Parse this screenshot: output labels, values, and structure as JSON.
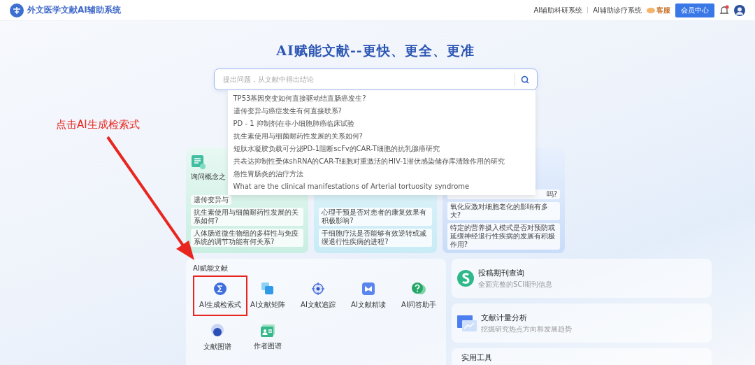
{
  "header": {
    "title": "外文医学文献AI辅助系统",
    "nav": [
      "AI辅助科研系统",
      "AI辅助诊疗系统"
    ],
    "service": "客服",
    "member_button": "会员中心",
    "notification": true
  },
  "hero": {
    "title": "AI赋能文献--更快、更全、更准"
  },
  "search": {
    "placeholder": "提出问题，从文献中得出结论",
    "suggestions": [
      "TP53基因突变如何直接驱动结直肠癌发生?",
      "遗传变异与癌症发生有何直接联系?",
      "PD - 1 抑制剂在非小细胞肺癌临床试验",
      "抗生素使用与细菌耐药性发展的关系如何?",
      "短肽水凝胶负载可分泌PD-1阻断scFv的CAR-T细胞的抗乳腺癌研究",
      "共表达抑制性受体shRNA的CAR-T细胞对重激活的HIV-1潜伏感染储存库清除作用的研究",
      "急性胃肠炎的治疗方法",
      "What are the clinical manifestations of Arterial tortuosity syndrome"
    ]
  },
  "annotation": {
    "text": "点击AI生成检索式"
  },
  "question_cards": [
    {
      "title": "询问概念之",
      "questions": [
        "遗传变异与",
        "抗生素使用与细菌耐药性发展的关系如何?",
        "人体肠道微生物组的多样性与免疫系统的调节功能有何关系?"
      ]
    },
    {
      "questions": [
        "心理干预是否对患者的康复效果有积极影响?",
        "干细胞疗法是否能够有效逆转或减缓退行性疾病的进程?"
      ]
    },
    {
      "questions": [
        "吗?",
        "氧化应激对细胞老化的影响有多大?",
        "特定的营养摄入模式是否对预防或延缓神经退行性疾病的发展有积极作用?"
      ]
    }
  ],
  "tools_section": {
    "title": "AI赋能文献",
    "tools": [
      {
        "label": "AI生成检索式",
        "kind": "sigma",
        "selected": true
      },
      {
        "label": "AI文献矩阵",
        "kind": "stack",
        "selected": false
      },
      {
        "label": "AI文献追踪",
        "kind": "target",
        "selected": false
      },
      {
        "label": "AI文献精读",
        "kind": "book",
        "selected": false
      },
      {
        "label": "AI问答助手",
        "kind": "chat",
        "selected": false
      },
      {
        "label": "文献图谱",
        "kind": "graph",
        "selected": false
      },
      {
        "label": "作者图谱",
        "kind": "author",
        "selected": false
      }
    ]
  },
  "side_cards": [
    {
      "kind": "journal",
      "title": "投稿期刊查询",
      "subtitle": "全面完整的SCI期刊信息"
    },
    {
      "kind": "analysis",
      "title": "文献计量分析",
      "subtitle": "挖掘研究热点方向和发展趋势"
    },
    {
      "kind": "tools",
      "title": "实用工具"
    }
  ]
}
